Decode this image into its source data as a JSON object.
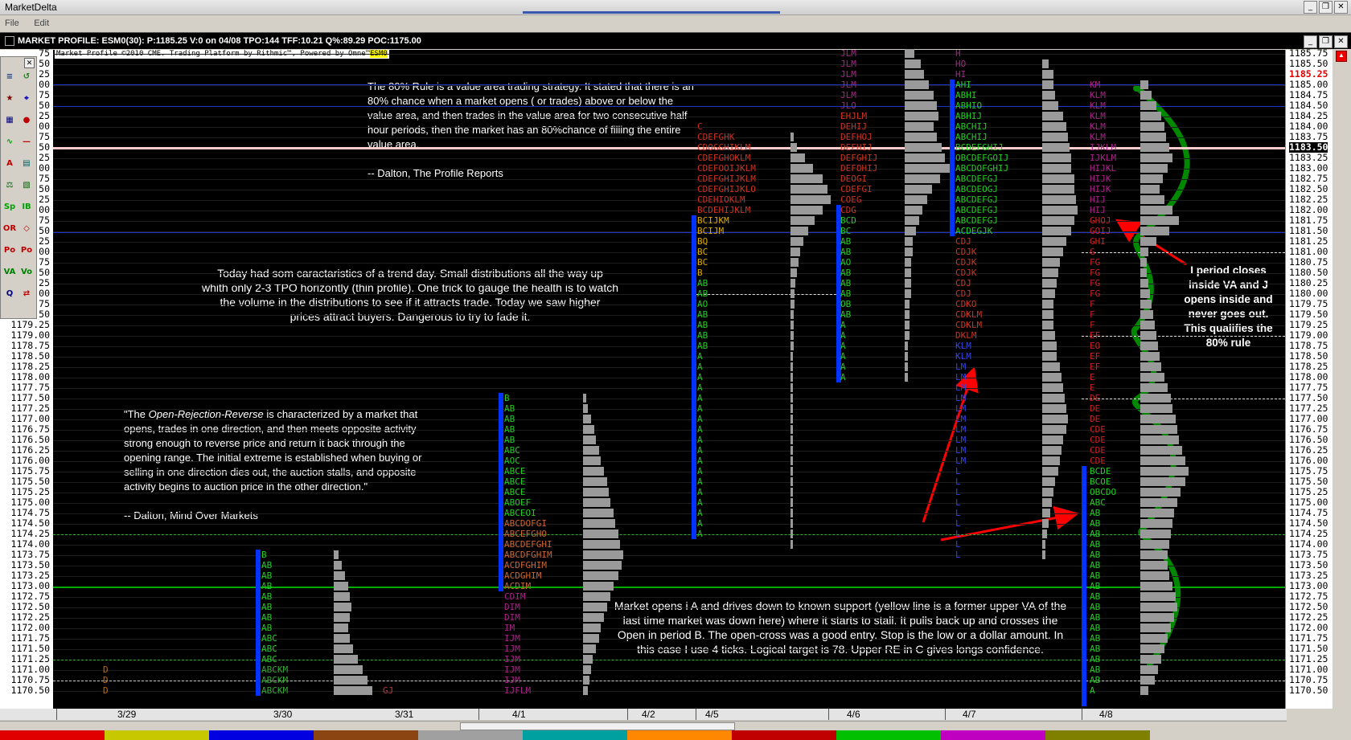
{
  "window": {
    "title": "MarketDelta",
    "menu": [
      "File",
      "Edit"
    ]
  },
  "chart_header": {
    "text": "MARKET PROFILE: ESM0(30): P:1185.25 V:0 on 04/08 TPO:144 TFF:10.21 Q%:89.29 POC:1175.00"
  },
  "copyright": {
    "text": "Market Profile ©2010 CME. Trading Platform by Rithmic™, Powered by Omne™",
    "symbol": "ESM0"
  },
  "left_axis_ticks": [
    "75",
    "50",
    "25",
    "00",
    "75",
    "50",
    "25",
    "00",
    "75",
    "50",
    "25",
    "00",
    "75",
    "50",
    "25",
    "00",
    "75",
    "50",
    "25",
    "00",
    "75",
    "50",
    "25",
    "00",
    "75",
    "50",
    "1179.25",
    "1179.00",
    "1178.75",
    "1178.50",
    "1178.25",
    "1178.00",
    "1177.75",
    "1177.50",
    "1177.25",
    "1177.00",
    "1176.75",
    "1176.50",
    "1176.25",
    "1176.00",
    "1175.75",
    "1175.50",
    "1175.25",
    "1175.00",
    "1174.75",
    "1174.50",
    "1174.25",
    "1174.00",
    "1173.75",
    "1173.50",
    "1173.25",
    "1173.00",
    "1172.75",
    "1172.50",
    "1172.25",
    "1172.00",
    "1171.75",
    "1171.50",
    "1171.25",
    "1171.00",
    "1170.75",
    "1170.50"
  ],
  "right_axis_ticks": [
    "1185.75",
    "1185.50",
    "1185.25",
    "1185.00",
    "1184.75",
    "1184.50",
    "1184.25",
    "1184.00",
    "1183.75",
    "1183.50",
    "1183.25",
    "1183.00",
    "1182.75",
    "1182.50",
    "1182.25",
    "1182.00",
    "1181.75",
    "1181.50",
    "1181.25",
    "1181.00",
    "1180.75",
    "1180.50",
    "1180.25",
    "1180.00",
    "1179.75",
    "1179.50",
    "1179.25",
    "1179.00",
    "1178.75",
    "1178.50",
    "1178.25",
    "1178.00",
    "1177.75",
    "1177.50",
    "1177.25",
    "1177.00",
    "1176.75",
    "1176.50",
    "1176.25",
    "1176.00",
    "1175.75",
    "1175.50",
    "1175.25",
    "1175.00",
    "1174.75",
    "1174.50",
    "1174.25",
    "1174.00",
    "1173.75",
    "1173.50",
    "1173.25",
    "1173.00",
    "1172.75",
    "1172.50",
    "1172.25",
    "1172.00",
    "1171.75",
    "1171.50",
    "1171.25",
    "1171.00",
    "1170.75",
    "1170.50"
  ],
  "last_price": "1185.25",
  "current_price": "1183.50",
  "dates": [
    "3/29",
    "3/30",
    "3/31",
    "4/1",
    "4/2",
    "4/5",
    "4/6",
    "4/7",
    "4/8"
  ],
  "notes": {
    "rule80": [
      "The 80% Rule is a value area trading strategy. It stated that there is an",
      "80% chance when a market opens  ( or trades)    above or below the",
      "value area, and then trades in the value area for two consecutive half",
      "hour periods, then the market has an 80%chance of filling the entire",
      "value area."
    ],
    "rule80_src": "-- Dalton, The Profile Reports",
    "trend": [
      "Today had som caractaristics of a trend day. Small distributions all the way up",
      "whith only 2-3 TPO horizontly (thin profile). One trick to gauge the health is to watch",
      "the volume in the distributions to see if it attracts trade. Today we saw higher",
      "prices attract buyers. Dangerous to try to fade it."
    ],
    "orr_intro": "\"The ",
    "orr_italic": "Open-Rejection-Reverse",
    "orr_rest": [
      " is characterized by a market that",
      "opens, trades in one direction, and then meets opposite activity",
      "strong enough to reverse price and return it back through the",
      "opening range. The initial extreme is established when buying or",
      "selling in one direction dies out, the auction stalls, and opposite",
      "activity begins to auction price in the other direction.\""
    ],
    "orr_src": "-- Dalton, Mind Over Markets",
    "market": [
      "Market opens i A and drives down to known support (yellow line is a former upper VA of the",
      "last time market was down here) where it starts to stall. It pulls back up and crosses the",
      "Open in period B. The open-cross was a good entry. Stop is the low or a dollar amount. In",
      "this case I use 4 ticks. Logical target is 78. Upper RE in C gives longs confidence."
    ],
    "iperiod": [
      "I period closes",
      "inside VA and J",
      "opens inside and",
      "never goes out.",
      "This qualifies the",
      "80% rule"
    ]
  },
  "colors": {
    "blue_va": "#0033ff",
    "green_line": "#00aa00",
    "red_arrow": "#ff0000",
    "curve": "#008800"
  }
}
